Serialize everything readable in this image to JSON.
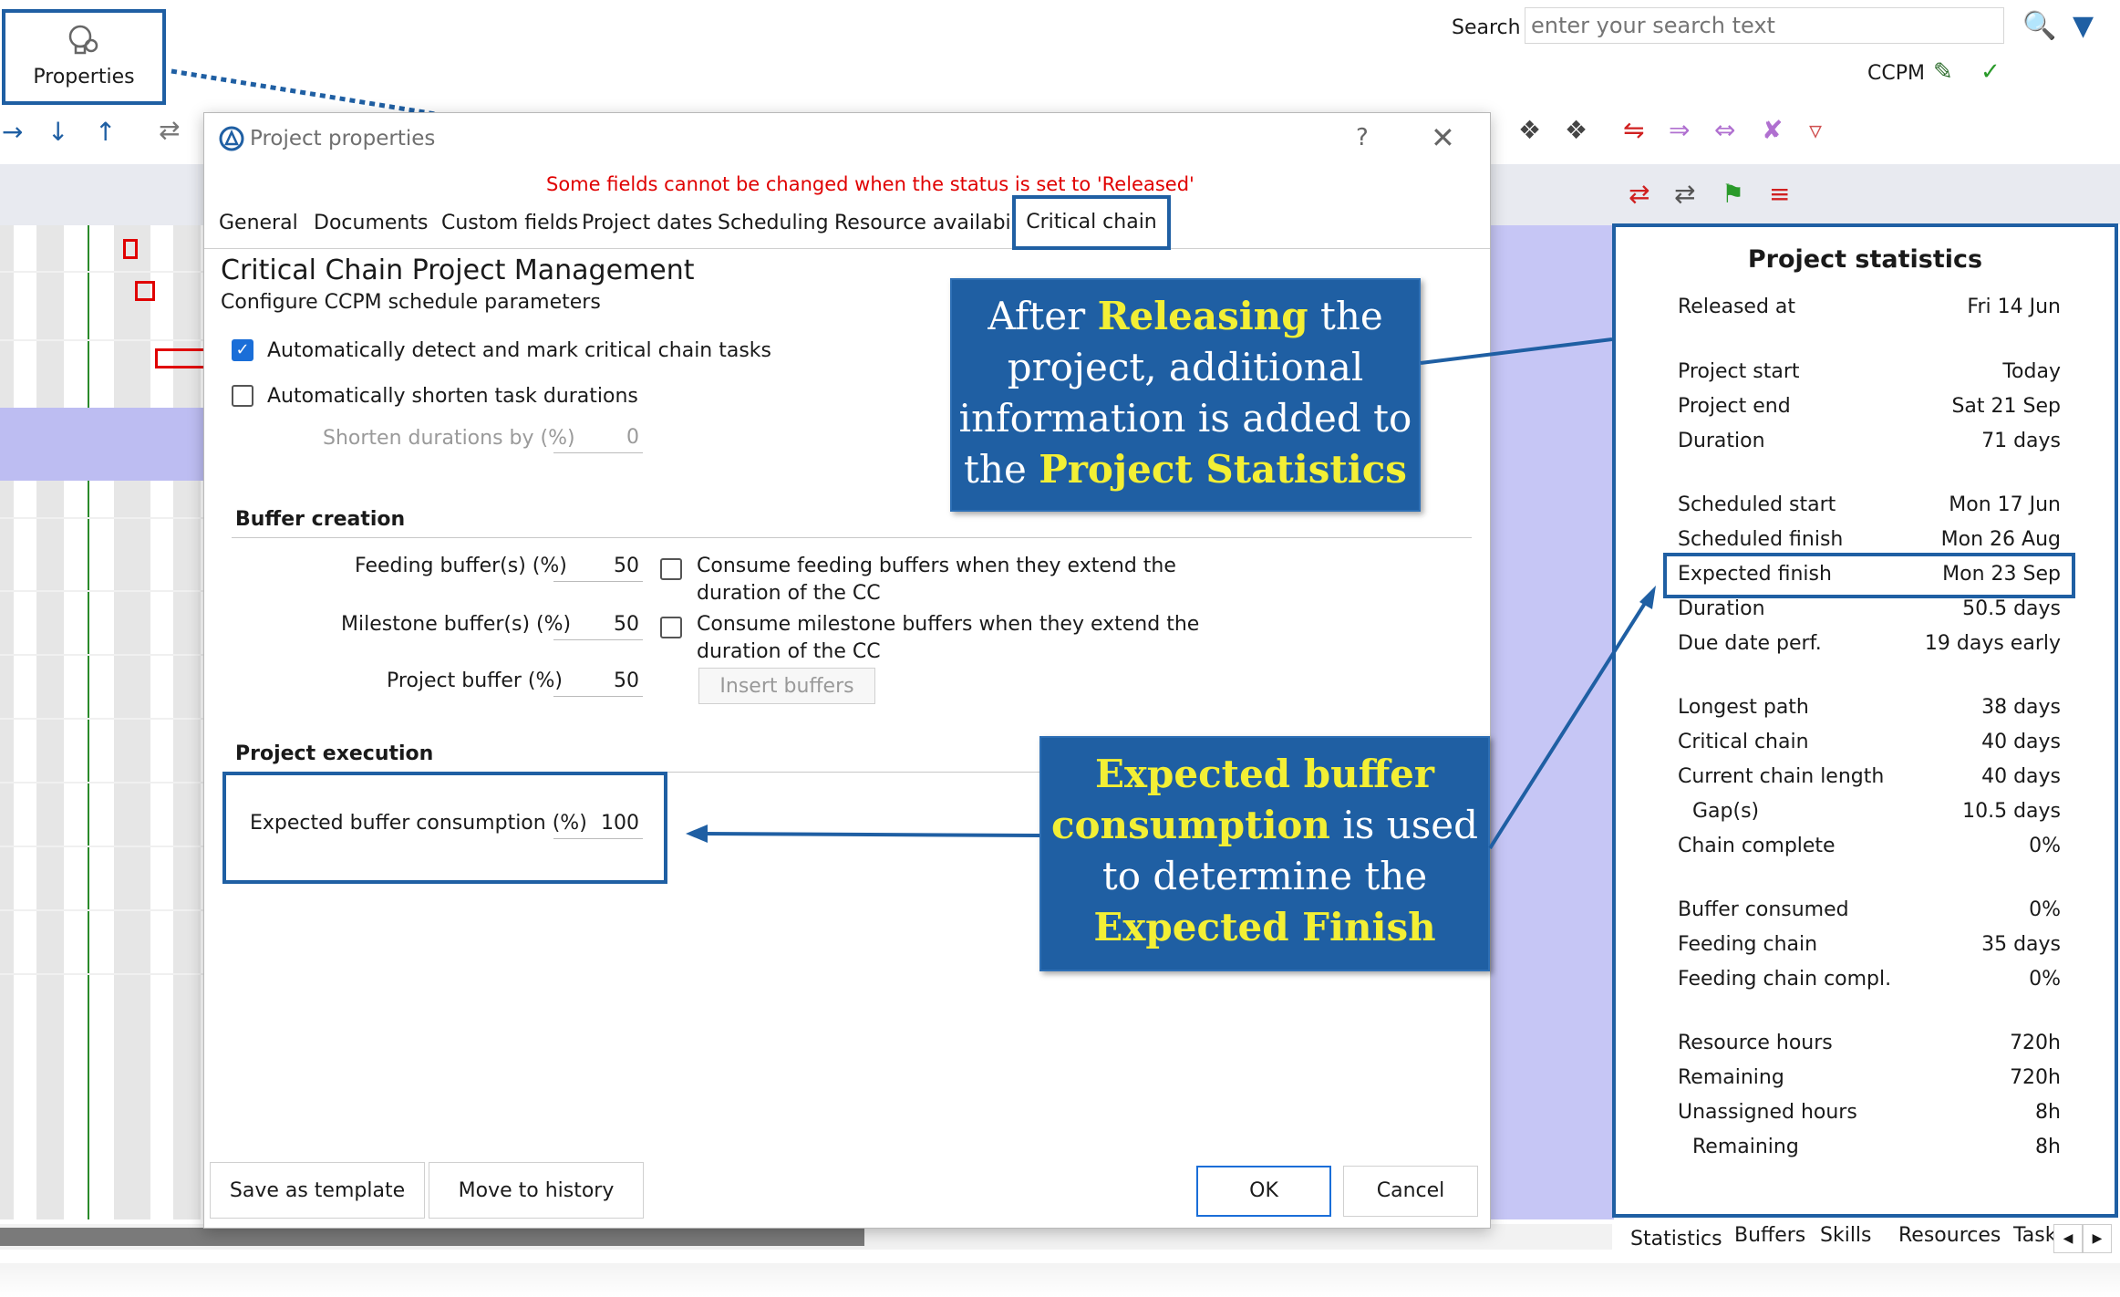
{
  "toolbar": {
    "properties_label": "Properties",
    "search_label": "Search",
    "search_placeholder": "enter your search text",
    "ccpm_label": "CCPM"
  },
  "dialog": {
    "title": "Project properties",
    "help": "?",
    "close": "✕",
    "warning": "Some fields cannot be changed when the status is set to 'Released'",
    "tabs": [
      "General",
      "Documents",
      "Custom fields",
      "Project dates",
      "Scheduling",
      "Resource availability",
      "Critical chain"
    ],
    "heading": "Critical Chain Project Management",
    "subheading": "Configure CCPM schedule parameters",
    "auto_detect_label": "Automatically detect and mark critical chain tasks",
    "auto_shorten_label": "Automatically shorten task durations",
    "shorten_label": "Shorten durations by (%)",
    "shorten_value": "0",
    "buffer_section": "Buffer creation",
    "feeding_label": "Feeding buffer(s) (%)",
    "feeding_value": "50",
    "milestone_label": "Milestone buffer(s) (%)",
    "milestone_value": "50",
    "project_buffer_label": "Project buffer (%)",
    "project_buffer_value": "50",
    "consume_feeding_line1": "Consume feeding buffers when they extend the",
    "consume_feeding_line2": "duration of the CC",
    "consume_milestone_line1": "Consume milestone buffers when they extend the",
    "consume_milestone_line2": "duration of the CC",
    "insert_buffers": "Insert buffers",
    "execution_section": "Project execution",
    "expected_consumption_label": "Expected buffer consumption (%)",
    "expected_consumption_value": "100",
    "save_template": "Save as template",
    "move_history": "Move to history",
    "ok": "OK",
    "cancel": "Cancel"
  },
  "callouts": {
    "release": {
      "p1": "After ",
      "h1": "Releasing",
      "p2": " the project, additional information is added to the ",
      "h2": "Project Statistics"
    },
    "buffer": {
      "h1": "Expected buffer consumption",
      "p1": " is used to determine the ",
      "h2": "Expected Finish"
    }
  },
  "stats": {
    "title": "Project statistics",
    "rows": [
      {
        "label": "Released at",
        "value": "Fri 14 Jun"
      },
      {
        "label": "Project start",
        "value": "Today"
      },
      {
        "label": "Project end",
        "value": "Sat 21 Sep"
      },
      {
        "label": "Duration",
        "value": "71 days"
      },
      {
        "label": "Scheduled start",
        "value": "Mon 17 Jun"
      },
      {
        "label": "Scheduled finish",
        "value": "Mon 26 Aug"
      },
      {
        "label": "Expected finish",
        "value": "Mon 23 Sep"
      },
      {
        "label": "Duration",
        "value": "50.5 days"
      },
      {
        "label": "Due date perf.",
        "value": "19 days early"
      },
      {
        "label": "Longest path",
        "value": "38 days"
      },
      {
        "label": "Critical chain",
        "value": "40 days"
      },
      {
        "label": "Current chain length",
        "value": "40 days"
      },
      {
        "label": "Gap(s)",
        "value": "10.5 days"
      },
      {
        "label": "Chain complete",
        "value": "0%"
      },
      {
        "label": "Buffer consumed",
        "value": "0%"
      },
      {
        "label": "Feeding chain",
        "value": "35 days"
      },
      {
        "label": "Feeding chain compl.",
        "value": "0%"
      },
      {
        "label": "Resource hours",
        "value": "720h"
      },
      {
        "label": "Remaining",
        "value": "720h"
      },
      {
        "label": "Unassigned hours",
        "value": "8h"
      },
      {
        "label": "Remaining",
        "value": "8h"
      }
    ],
    "tabs": [
      "Statistics",
      "Buffers",
      "Skills",
      "Resources",
      "Task"
    ]
  }
}
